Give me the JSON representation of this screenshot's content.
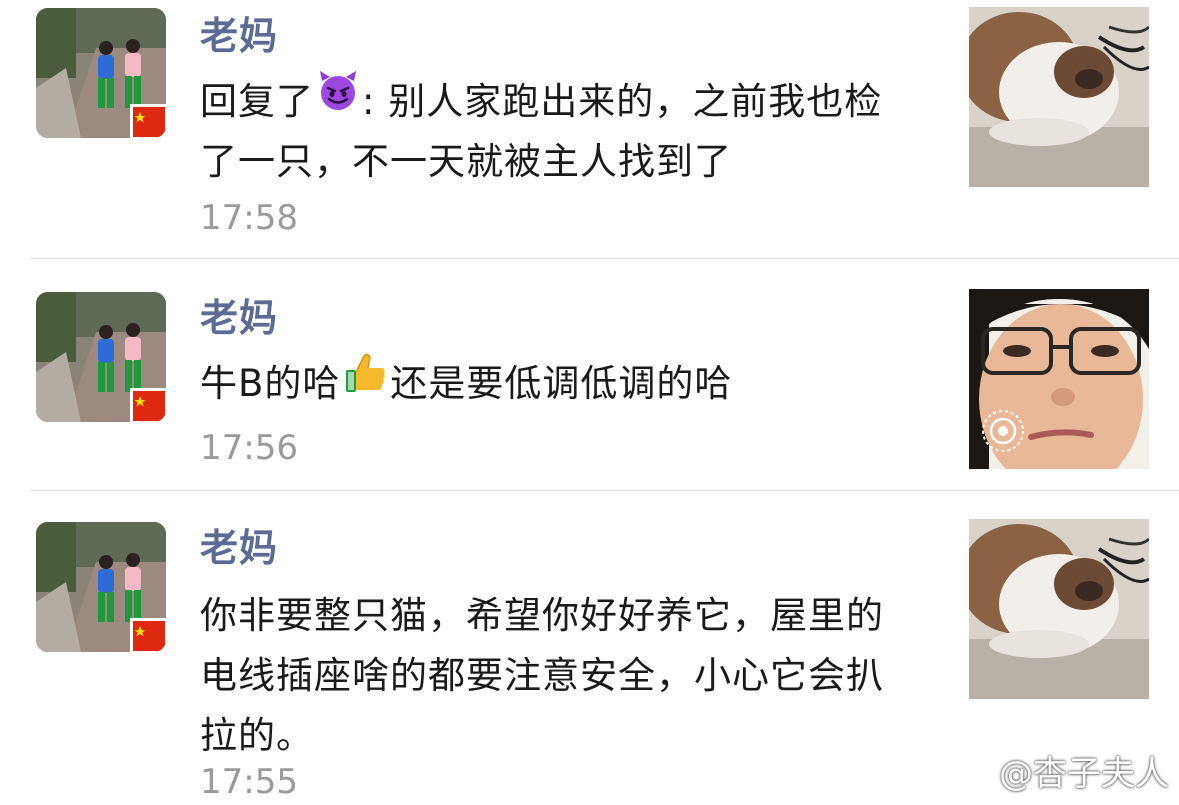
{
  "messages": [
    {
      "sender": "老妈",
      "reply_prefix": "回复了",
      "reply_emoji": "smiling-imp-emoji",
      "text_after_emoji": ": 别人家跑出来的，之前我也检了一只，不一天就被主人找到了",
      "time": "17:58",
      "thumbnail": "cat-photo"
    },
    {
      "sender": "老妈",
      "text_before_emoji": "牛B的哈",
      "inline_emoji": "thumbs-up-emoji",
      "text_after_emoji": "还是要低调低调的哈",
      "time": "17:56",
      "thumbnail": "selfie-live-photo"
    },
    {
      "sender": "老妈",
      "text": "你非要整只猫，希望你好好养它，屋里的电线插座啥的都要注意安全，小心它会扒拉的。",
      "time": "17:55",
      "thumbnail": "cat-photo"
    }
  ],
  "watermark": {
    "text": "@杏子夫人",
    "icon": "weibo-icon"
  },
  "colors": {
    "sender_name": "#5b6b93",
    "timestamp": "#9a9a9a",
    "message_text": "#1a1a1a",
    "divider": "#e3e3e3"
  }
}
